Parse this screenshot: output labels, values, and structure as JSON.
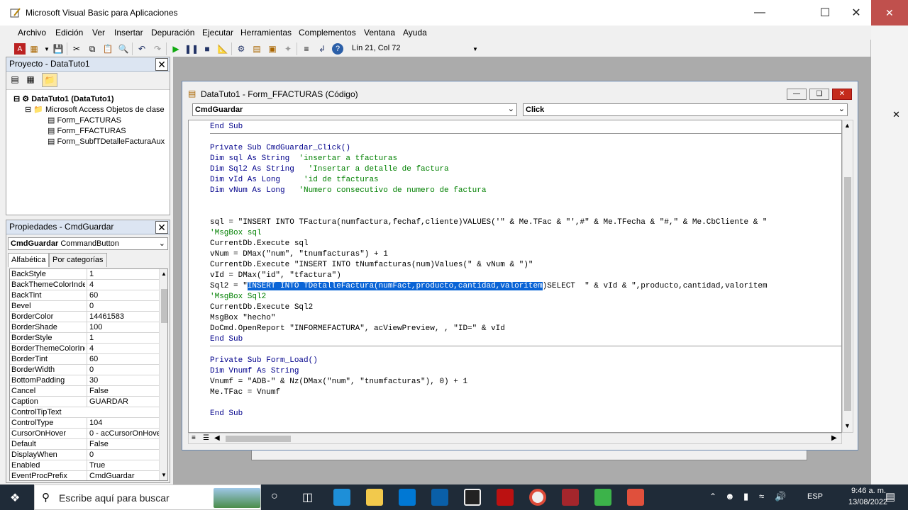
{
  "window": {
    "title": "Microsoft Visual Basic para Aplicaciones"
  },
  "menu": [
    "Archivo",
    "Edición",
    "Ver",
    "Insertar",
    "Depuración",
    "Ejecutar",
    "Herramientas",
    "Complementos",
    "Ventana",
    "Ayuda"
  ],
  "toolbar": {
    "position": "Lín 21, Col 72"
  },
  "project": {
    "title": "Proyecto - DataTuto1",
    "root": "DataTuto1 (DataTuto1)",
    "folder": "Microsoft Access Objetos de clase",
    "items": [
      "Form_FACTURAS",
      "Form_FFACTURAS",
      "Form_SubfTDetalleFacturaAux"
    ]
  },
  "properties": {
    "title": "Propiedades - CmdGuardar",
    "object_name": "CmdGuardar",
    "object_type": "CommandButton",
    "tab_alpha": "Alfabética",
    "tab_cat": "Por categorías",
    "rows": [
      [
        "BackStyle",
        "1"
      ],
      [
        "BackThemeColorIndex",
        "4"
      ],
      [
        "BackTint",
        "60"
      ],
      [
        "Bevel",
        "0"
      ],
      [
        "BorderColor",
        "14461583"
      ],
      [
        "BorderShade",
        "100"
      ],
      [
        "BorderStyle",
        "1"
      ],
      [
        "BorderThemeColorInde",
        "4"
      ],
      [
        "BorderTint",
        "60"
      ],
      [
        "BorderWidth",
        "0"
      ],
      [
        "BottomPadding",
        "30"
      ],
      [
        "Cancel",
        "False"
      ],
      [
        "Caption",
        "GUARDAR"
      ],
      [
        "ControlTipText",
        ""
      ],
      [
        "ControlType",
        "104"
      ],
      [
        "CursorOnHover",
        "0 - acCursorOnHoverI"
      ],
      [
        "Default",
        "False"
      ],
      [
        "DisplayWhen",
        "0"
      ],
      [
        "Enabled",
        "True"
      ],
      [
        "EventProcPrefix",
        "CmdGuardar"
      ]
    ]
  },
  "codewin": {
    "title": "DataTuto1 - Form_FFACTURAS (Código)",
    "object_combo": "CmdGuardar",
    "proc_combo": "Click"
  },
  "code": {
    "l00": "End Sub",
    "l02": "Private Sub CmdGuardar_Click()",
    "l03a": "Dim sql As String  ",
    "l03b": "'insertar a tfacturas",
    "l04a": "Dim Sql2 As String   ",
    "l04b": "'Insertar a detalle de factura",
    "l05a": "Dim vId As Long     ",
    "l05b": "'id de tfacturas",
    "l06a": "Dim vNum As Long   ",
    "l06b": "'Numero consecutivo de numero de factura",
    "l09": "sql = \"INSERT INTO TFactura(numfactura,fechaf,cliente)VALUES('\" & Me.TFac & \"',#\" & Me.TFecha & \"#,\" & Me.CbCliente & \"",
    "l10": "'MsgBox sql",
    "l11": "CurrentDb.Execute sql",
    "l12": "vNum = DMax(\"num\", \"tnumfacturas\") + 1",
    "l13": "CurrentDb.Execute \"INSERT INTO tNumfacturas(num)Values(\" & vNum & \")\"",
    "l14": "vId = DMax(\"id\", \"tfactura\")",
    "l15a": "Sql2 = \"",
    "l15b": "INSERT INTO TDetalleFactura(numFact,producto,cantidad,valoritem",
    "l15c": ")SELECT  \" & vId & \",producto,cantidad,valoritem",
    "l16": "'MsgBox Sql2",
    "l17": "CurrentDb.Execute Sql2",
    "l18": "MsgBox \"hecho\"",
    "l19": "DoCmd.OpenReport \"INFORMEFACTURA\", acViewPreview, , \"ID=\" & vId",
    "l20": "End Sub",
    "l22": "Private Sub Form_Load()",
    "l23": "Dim Vnumf As String",
    "l24": "Vnumf = \"ADB-\" & Nz(DMax(\"num\", \"tnumfacturas\"), 0) + 1",
    "l25": "Me.TFac = Vnumf",
    "l27": "End Sub"
  },
  "taskbar": {
    "search_placeholder": "Escribe aquí para buscar",
    "lang": "ESP",
    "time": "9:46 a. m.",
    "date": "13/08/2022"
  },
  "colors": {
    "keyword": "#00008b",
    "comment": "#008000",
    "selection": "#0a64d6"
  }
}
